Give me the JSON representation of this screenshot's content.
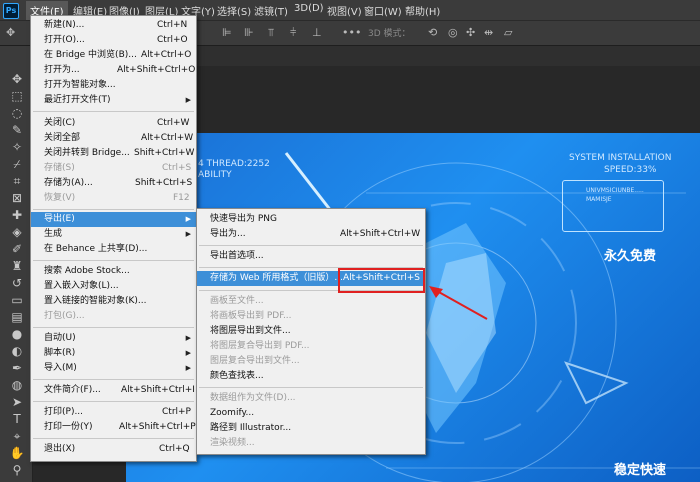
{
  "app": {
    "logo": "Ps"
  },
  "menubar": [
    "文件(F)",
    "编辑(E)",
    "图像(I)",
    "图层(L)",
    "文字(Y)",
    "选择(S)",
    "滤镜(T)",
    "3D(D)",
    "视图(V)",
    "窗口(W)",
    "帮助(H)"
  ],
  "options": {
    "mode_label": "3D 模式："
  },
  "file_menu": [
    {
      "label": "新建(N)...",
      "shortcut": "Ctrl+N"
    },
    {
      "label": "打开(O)...",
      "shortcut": "Ctrl+O"
    },
    {
      "label": "在 Bridge 中浏览(B)...",
      "shortcut": "Alt+Ctrl+O"
    },
    {
      "label": "打开为...",
      "shortcut": "Alt+Shift+Ctrl+O"
    },
    {
      "label": "打开为智能对象...",
      "shortcut": ""
    },
    {
      "label": "最近打开文件(T)",
      "shortcut": ""
    },
    {
      "label": "关闭(C)",
      "shortcut": "Ctrl+W"
    },
    {
      "label": "关闭全部",
      "shortcut": "Alt+Ctrl+W"
    },
    {
      "label": "关闭并转到 Bridge...",
      "shortcut": "Shift+Ctrl+W"
    },
    {
      "label": "存储(S)",
      "shortcut": "Ctrl+S"
    },
    {
      "label": "存储为(A)...",
      "shortcut": "Shift+Ctrl+S"
    },
    {
      "label": "恢复(V)",
      "shortcut": "F12"
    },
    {
      "label": "导出(E)",
      "shortcut": ""
    },
    {
      "label": "生成",
      "shortcut": ""
    },
    {
      "label": "在 Behance 上共享(D)...",
      "shortcut": ""
    },
    {
      "label": "搜索 Adobe Stock...",
      "shortcut": ""
    },
    {
      "label": "置入嵌入对象(L)...",
      "shortcut": ""
    },
    {
      "label": "置入链接的智能对象(K)...",
      "shortcut": ""
    },
    {
      "label": "打包(G)...",
      "shortcut": ""
    },
    {
      "label": "自动(U)",
      "shortcut": ""
    },
    {
      "label": "脚本(R)",
      "shortcut": ""
    },
    {
      "label": "导入(M)",
      "shortcut": ""
    },
    {
      "label": "文件简介(F)...",
      "shortcut": "Alt+Shift+Ctrl+I"
    },
    {
      "label": "打印(P)...",
      "shortcut": "Ctrl+P"
    },
    {
      "label": "打印一份(Y)",
      "shortcut": "Alt+Shift+Ctrl+P"
    },
    {
      "label": "退出(X)",
      "shortcut": "Ctrl+Q"
    }
  ],
  "export_menu": [
    {
      "label": "快速导出为 PNG",
      "shortcut": ""
    },
    {
      "label": "导出为...",
      "shortcut": "Alt+Shift+Ctrl+W"
    },
    {
      "label": "导出首选项...",
      "shortcut": ""
    },
    {
      "label": "存储为 Web 所用格式（旧版）...",
      "shortcut": "Alt+Shift+Ctrl+S"
    },
    {
      "label": "画板至文件...",
      "shortcut": ""
    },
    {
      "label": "将画板导出到 PDF...",
      "shortcut": ""
    },
    {
      "label": "将图层导出到文件...",
      "shortcut": ""
    },
    {
      "label": "将图层复合导出到 PDF...",
      "shortcut": ""
    },
    {
      "label": "图层复合导出到文件...",
      "shortcut": ""
    },
    {
      "label": "颜色查找表...",
      "shortcut": ""
    },
    {
      "label": "数据组作为文件(D)...",
      "shortcut": ""
    },
    {
      "label": "Zoomify...",
      "shortcut": ""
    },
    {
      "label": "路径到 Illustrator...",
      "shortcut": ""
    },
    {
      "label": "渲染视频...",
      "shortcut": ""
    }
  ],
  "canvas": {
    "thread_text": "4  THREAD:2252",
    "ability_text": "ABILITY",
    "system_title": "SYSTEM INSTALLATION",
    "speed_text": "SPEED:33%",
    "hud_line1": "UNIVMSICIUNBE.....",
    "hud_line2": "MAMISJE",
    "badge_free": "永久免费",
    "badge_fast": "稳定快速"
  },
  "colors": {
    "highlight": "#3d8fd8",
    "annotation": "#e02020",
    "canvas_blue": "#1f8ff0"
  }
}
